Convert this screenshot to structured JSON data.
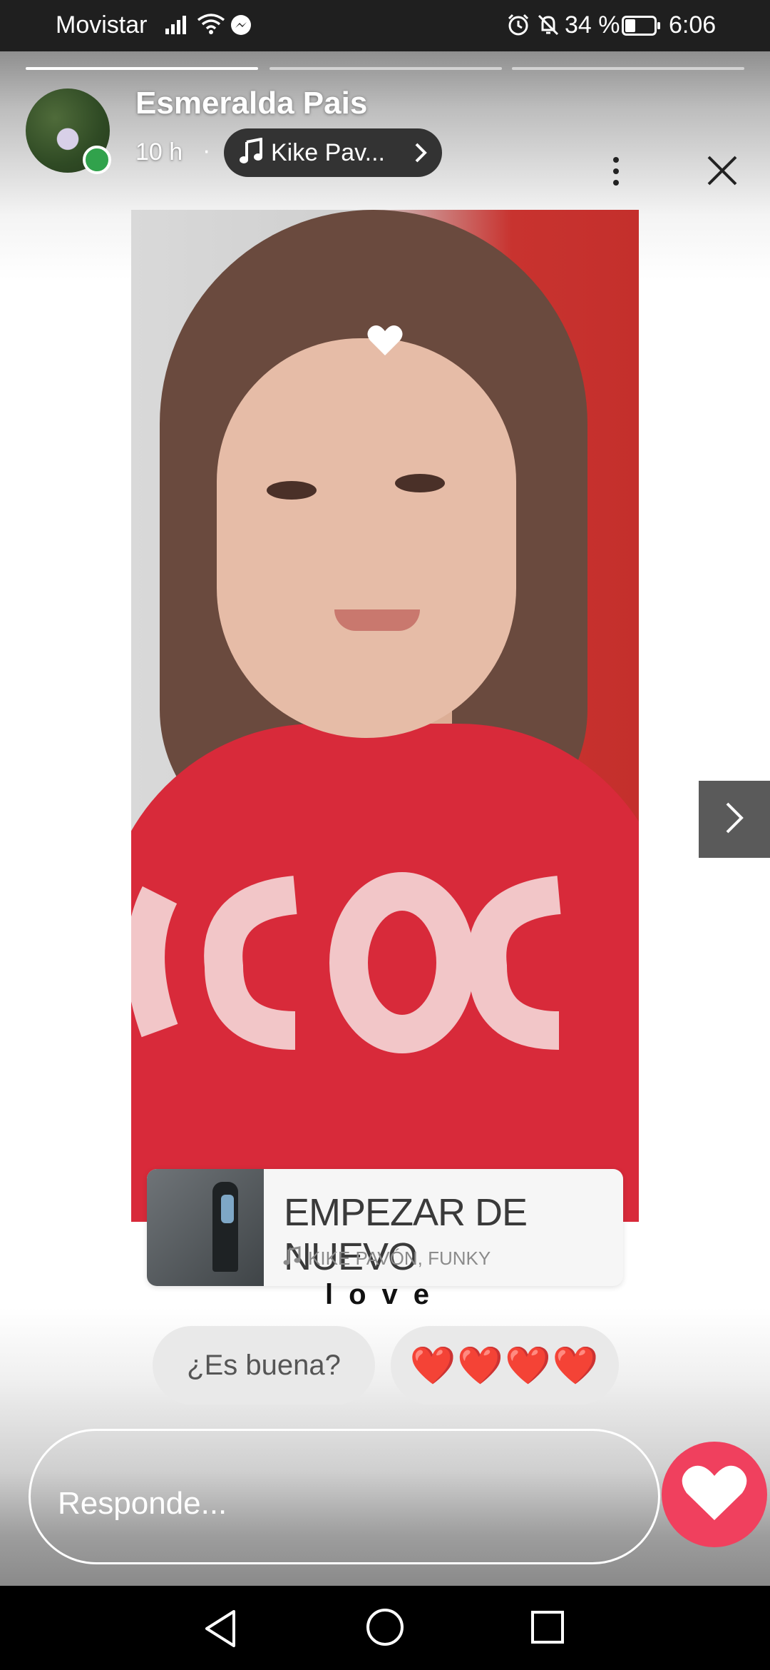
{
  "status_bar": {
    "carrier": "Movistar",
    "battery_percent": "34 %",
    "time": "6:06"
  },
  "story": {
    "username": "Esmeralda Pais",
    "time_ago": "10 h",
    "separator": "·",
    "music_chip_label": "Kike Pav...",
    "progress_segments": 3,
    "active_segment": 1
  },
  "music_sticker": {
    "song_title": "EMPEZAR DE NUEVO",
    "artist": "KIKE PAVÓN, FUNKY"
  },
  "caption": "love",
  "quick_replies": {
    "chip_1": "¿Es buena?",
    "chip_2": "❤️❤️❤️❤️"
  },
  "reply": {
    "placeholder": "Responde..."
  },
  "colors": {
    "online_dot": "#31a24c",
    "like_button": "#f0405e",
    "status_bar_bg": "#1f1f1f"
  },
  "icons": {
    "status": [
      "signal-icon",
      "wifi-icon",
      "messenger-icon",
      "alarm-icon",
      "mute-icon",
      "battery-icon"
    ],
    "header": [
      "music-note-icon",
      "chevron-right-icon",
      "more-vert-icon",
      "close-icon"
    ],
    "nav": [
      "back-icon",
      "home-icon",
      "recents-icon"
    ]
  }
}
